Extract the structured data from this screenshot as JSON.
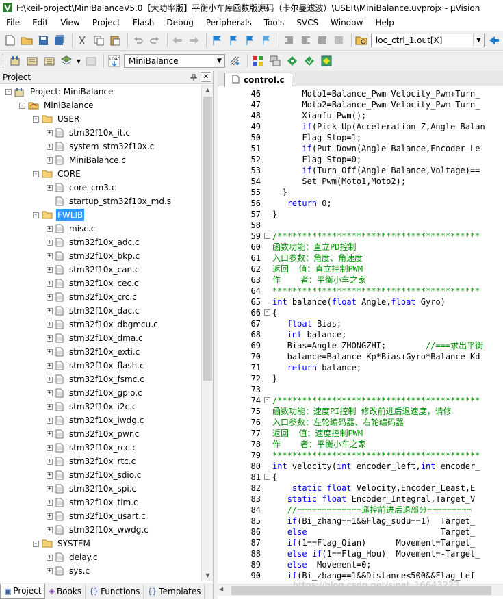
{
  "window": {
    "title": "F:\\keil-project\\MiniBalanceV5.0【大功率版】平衡小车库函数版源码（卡尔曼滤波）\\USER\\MiniBalance.uvprojx - µVision"
  },
  "menu": [
    "File",
    "Edit",
    "View",
    "Project",
    "Flash",
    "Debug",
    "Peripherals",
    "Tools",
    "SVCS",
    "Window",
    "Help"
  ],
  "toolbar1": {
    "find_combo_value": "loc_ctrl_1.out[X]"
  },
  "toolbar2": {
    "target_combo_value": "MiniBalance"
  },
  "project_panel": {
    "title": "Project",
    "tree": [
      {
        "label": "Project: MiniBalance",
        "level": 0,
        "kind": "project",
        "toggle": "-"
      },
      {
        "label": "MiniBalance",
        "level": 1,
        "kind": "target",
        "toggle": "-"
      },
      {
        "label": "USER",
        "level": 2,
        "kind": "folder",
        "toggle": "-"
      },
      {
        "label": "stm32f10x_it.c",
        "level": 3,
        "kind": "file",
        "toggle": "+"
      },
      {
        "label": "system_stm32f10x.c",
        "level": 3,
        "kind": "file",
        "toggle": "+"
      },
      {
        "label": "MiniBalance.c",
        "level": 3,
        "kind": "file",
        "toggle": "+"
      },
      {
        "label": "CORE",
        "level": 2,
        "kind": "folder",
        "toggle": "-"
      },
      {
        "label": "core_cm3.c",
        "level": 3,
        "kind": "file",
        "toggle": "+"
      },
      {
        "label": "startup_stm32f10x_md.s",
        "level": 3,
        "kind": "file",
        "toggle": ""
      },
      {
        "label": "FWLIB",
        "level": 2,
        "kind": "folder",
        "toggle": "-",
        "selected": true
      },
      {
        "label": "misc.c",
        "level": 3,
        "kind": "file",
        "toggle": "+"
      },
      {
        "label": "stm32f10x_adc.c",
        "level": 3,
        "kind": "file",
        "toggle": "+"
      },
      {
        "label": "stm32f10x_bkp.c",
        "level": 3,
        "kind": "file",
        "toggle": "+"
      },
      {
        "label": "stm32f10x_can.c",
        "level": 3,
        "kind": "file",
        "toggle": "+"
      },
      {
        "label": "stm32f10x_cec.c",
        "level": 3,
        "kind": "file",
        "toggle": "+"
      },
      {
        "label": "stm32f10x_crc.c",
        "level": 3,
        "kind": "file",
        "toggle": "+"
      },
      {
        "label": "stm32f10x_dac.c",
        "level": 3,
        "kind": "file",
        "toggle": "+"
      },
      {
        "label": "stm32f10x_dbgmcu.c",
        "level": 3,
        "kind": "file",
        "toggle": "+"
      },
      {
        "label": "stm32f10x_dma.c",
        "level": 3,
        "kind": "file",
        "toggle": "+"
      },
      {
        "label": "stm32f10x_exti.c",
        "level": 3,
        "kind": "file",
        "toggle": "+"
      },
      {
        "label": "stm32f10x_flash.c",
        "level": 3,
        "kind": "file",
        "toggle": "+"
      },
      {
        "label": "stm32f10x_fsmc.c",
        "level": 3,
        "kind": "file",
        "toggle": "+"
      },
      {
        "label": "stm32f10x_gpio.c",
        "level": 3,
        "kind": "file",
        "toggle": "+"
      },
      {
        "label": "stm32f10x_i2c.c",
        "level": 3,
        "kind": "file",
        "toggle": "+"
      },
      {
        "label": "stm32f10x_iwdg.c",
        "level": 3,
        "kind": "file",
        "toggle": "+"
      },
      {
        "label": "stm32f10x_pwr.c",
        "level": 3,
        "kind": "file",
        "toggle": "+"
      },
      {
        "label": "stm32f10x_rcc.c",
        "level": 3,
        "kind": "file",
        "toggle": "+"
      },
      {
        "label": "stm32f10x_rtc.c",
        "level": 3,
        "kind": "file",
        "toggle": "+"
      },
      {
        "label": "stm32f10x_sdio.c",
        "level": 3,
        "kind": "file",
        "toggle": "+"
      },
      {
        "label": "stm32f10x_spi.c",
        "level": 3,
        "kind": "file",
        "toggle": "+"
      },
      {
        "label": "stm32f10x_tim.c",
        "level": 3,
        "kind": "file",
        "toggle": "+"
      },
      {
        "label": "stm32f10x_usart.c",
        "level": 3,
        "kind": "file",
        "toggle": "+"
      },
      {
        "label": "stm32f10x_wwdg.c",
        "level": 3,
        "kind": "file",
        "toggle": "+"
      },
      {
        "label": "SYSTEM",
        "level": 2,
        "kind": "folder",
        "toggle": "-"
      },
      {
        "label": "delay.c",
        "level": 3,
        "kind": "file",
        "toggle": "+"
      },
      {
        "label": "sys.c",
        "level": 3,
        "kind": "file",
        "toggle": "+"
      }
    ],
    "bottom_tabs": [
      {
        "label": "Project",
        "icon": "project-icon",
        "active": true
      },
      {
        "label": "Books",
        "icon": "books-icon"
      },
      {
        "label": "Functions",
        "icon": "functions-icon"
      },
      {
        "label": "Templates",
        "icon": "templates-icon"
      }
    ]
  },
  "editor": {
    "tab": "control.c",
    "lines": [
      {
        "n": "46",
        "text": "      Moto1=Balance_Pwm-Velocity_Pwm+Turn_",
        "fold": ""
      },
      {
        "n": "47",
        "text": "      Moto2=Balance_Pwm-Velocity_Pwm-Turn_",
        "fold": ""
      },
      {
        "n": "48",
        "text": "      Xianfu_Pwm();",
        "fold": ""
      },
      {
        "n": "49",
        "text": "      if(Pick_Up(Acceleration_Z,Angle_Balan",
        "fold": ""
      },
      {
        "n": "50",
        "text": "      Flag_Stop=1;",
        "fold": ""
      },
      {
        "n": "51",
        "text": "      if(Put_Down(Angle_Balance,Encoder_Le",
        "fold": ""
      },
      {
        "n": "52",
        "text": "      Flag_Stop=0;",
        "fold": ""
      },
      {
        "n": "53",
        "text": "      if(Turn_Off(Angle_Balance,Voltage)==",
        "fold": ""
      },
      {
        "n": "54",
        "text": "      Set_Pwm(Moto1,Moto2);",
        "fold": ""
      },
      {
        "n": "55",
        "text": "  }",
        "fold": ""
      },
      {
        "n": "56",
        "text": "   return 0;",
        "fold": ""
      },
      {
        "n": "57",
        "text": "}",
        "fold": ""
      },
      {
        "n": "58",
        "text": "",
        "fold": ""
      },
      {
        "n": "59",
        "text": "/*****************************************",
        "fold": "-",
        "comment": true
      },
      {
        "n": "60",
        "text": "函数功能：直立PD控制",
        "fold": "",
        "comment": true
      },
      {
        "n": "61",
        "text": "入口参数：角度、角速度",
        "fold": "",
        "comment": true
      },
      {
        "n": "62",
        "text": "返回  值：直立控制PWM",
        "fold": "",
        "comment": true
      },
      {
        "n": "63",
        "text": "作    者：平衡小车之家",
        "fold": "",
        "comment": true
      },
      {
        "n": "64",
        "text": "******************************************",
        "fold": "",
        "comment": true
      },
      {
        "n": "65",
        "text": "int balance(float Angle,float Gyro)",
        "fold": ""
      },
      {
        "n": "66",
        "text": "{",
        "fold": "-"
      },
      {
        "n": "67",
        "text": "   float Bias;",
        "fold": ""
      },
      {
        "n": "68",
        "text": "   int balance;",
        "fold": ""
      },
      {
        "n": "69",
        "text": "   Bias=Angle-ZHONGZHI;        //===求出平衡",
        "fold": ""
      },
      {
        "n": "70",
        "text": "   balance=Balance_Kp*Bias+Gyro*Balance_Kd",
        "fold": ""
      },
      {
        "n": "71",
        "text": "   return balance;",
        "fold": ""
      },
      {
        "n": "72",
        "text": "}",
        "fold": ""
      },
      {
        "n": "73",
        "text": "",
        "fold": ""
      },
      {
        "n": "74",
        "text": "/*****************************************",
        "fold": "-",
        "comment": true
      },
      {
        "n": "75",
        "text": "函数功能：速度PI控制 修改前进后退速度，请修",
        "fold": "",
        "comment": true
      },
      {
        "n": "76",
        "text": "入口参数：左轮编码器、右轮编码器",
        "fold": "",
        "comment": true
      },
      {
        "n": "77",
        "text": "返回  值：速度控制PWM",
        "fold": "",
        "comment": true
      },
      {
        "n": "78",
        "text": "作    者：平衡小车之家",
        "fold": "",
        "comment": true
      },
      {
        "n": "79",
        "text": "******************************************",
        "fold": "",
        "comment": true
      },
      {
        "n": "80",
        "text": "int velocity(int encoder_left,int encoder_",
        "fold": ""
      },
      {
        "n": "81",
        "text": "{",
        "fold": "-"
      },
      {
        "n": "82",
        "text": "    static float Velocity,Encoder_Least,E",
        "fold": ""
      },
      {
        "n": "83",
        "text": "   static float Encoder_Integral,Target_V",
        "fold": ""
      },
      {
        "n": "84",
        "text": "   //=============遥控前进后退部分=========",
        "fold": ""
      },
      {
        "n": "85",
        "text": "   if(Bi_zhang==1&&Flag_sudu==1)  Target_",
        "fold": ""
      },
      {
        "n": "86",
        "text": "   else                           Target_",
        "fold": ""
      },
      {
        "n": "87",
        "text": "   if(1==Flag_Qian)      Movement=Target_",
        "fold": ""
      },
      {
        "n": "88",
        "text": "   else if(1==Flag_Hou)  Movement=-Target_",
        "fold": ""
      },
      {
        "n": "89",
        "text": "   else  Movement=0;",
        "fold": ""
      },
      {
        "n": "90",
        "text": "   if(Bi_zhang==1&&Distance<500&&Flag_Lef",
        "fold": ""
      }
    ],
    "watermark": "https://blog.csdn.net/sinat_16643223"
  }
}
